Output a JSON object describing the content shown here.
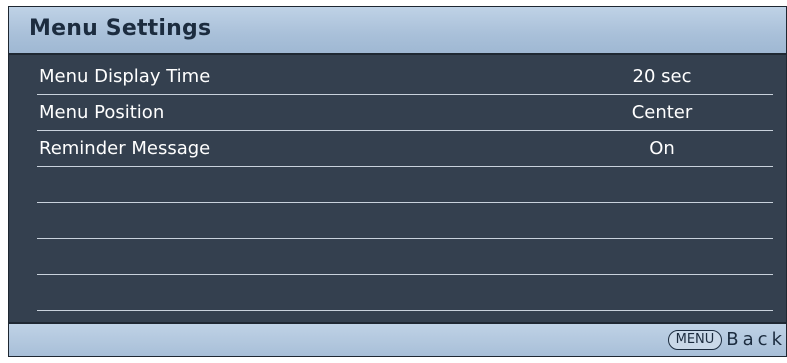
{
  "title": "Menu Settings",
  "rows": [
    {
      "label": "Menu Display Time",
      "value": "20 sec"
    },
    {
      "label": "Menu Position",
      "value": "Center"
    },
    {
      "label": "Reminder Message",
      "value": "On"
    },
    {
      "label": "",
      "value": ""
    },
    {
      "label": "",
      "value": ""
    },
    {
      "label": "",
      "value": ""
    },
    {
      "label": "",
      "value": ""
    }
  ],
  "footer": {
    "menu_key_label": "MENU",
    "back_label": "Back"
  },
  "colors": {
    "panel_bg": "#34404f",
    "header_bg": "#a9c0d9",
    "text_light": "#ffffff",
    "text_dark": "#1c2c3f"
  }
}
